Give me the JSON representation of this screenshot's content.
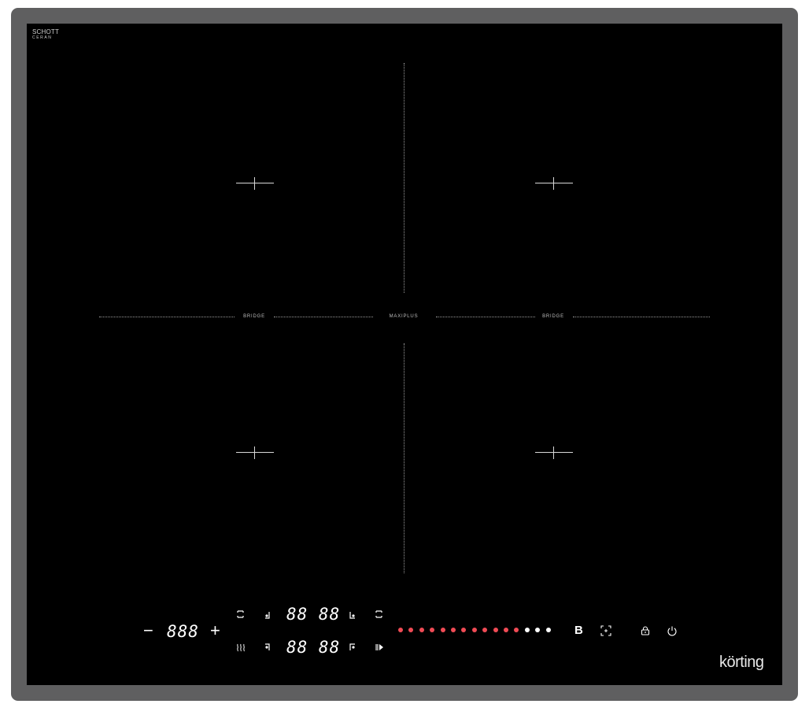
{
  "logo": {
    "line1": "SCHOTT",
    "line2": "CERAN"
  },
  "zones": {
    "bridge_left": "BRIDGE",
    "maxiplus": "MAXIPLUS",
    "bridge_right": "BRIDGE"
  },
  "controls": {
    "timer": {
      "minus": "−",
      "display": "888",
      "plus": "+"
    },
    "zone_display_top": "88 88",
    "zone_display_bottom": "88 88",
    "boost_key": "B",
    "power_level_count": 15,
    "power_level_active": 12,
    "colors": {
      "active": "#f04b55",
      "inactive": "#ffffff"
    }
  },
  "icons": {
    "cursor_front_left": "front-left-zone-icon",
    "cursor_rear_left": "rear-left-zone-icon",
    "cursor_front_right": "front-right-zone-icon",
    "cursor_rear_right": "rear-right-zone-icon",
    "bracket_top_left": "bridge-top-icon",
    "bracket_top_right": "bridge-top-right-icon",
    "keep_warm": "keep-warm-icon",
    "pause": "pause-play-icon",
    "auto_detect": "pan-detect-icon",
    "lock": "lock-icon",
    "power": "power-icon"
  },
  "brand": "körting"
}
